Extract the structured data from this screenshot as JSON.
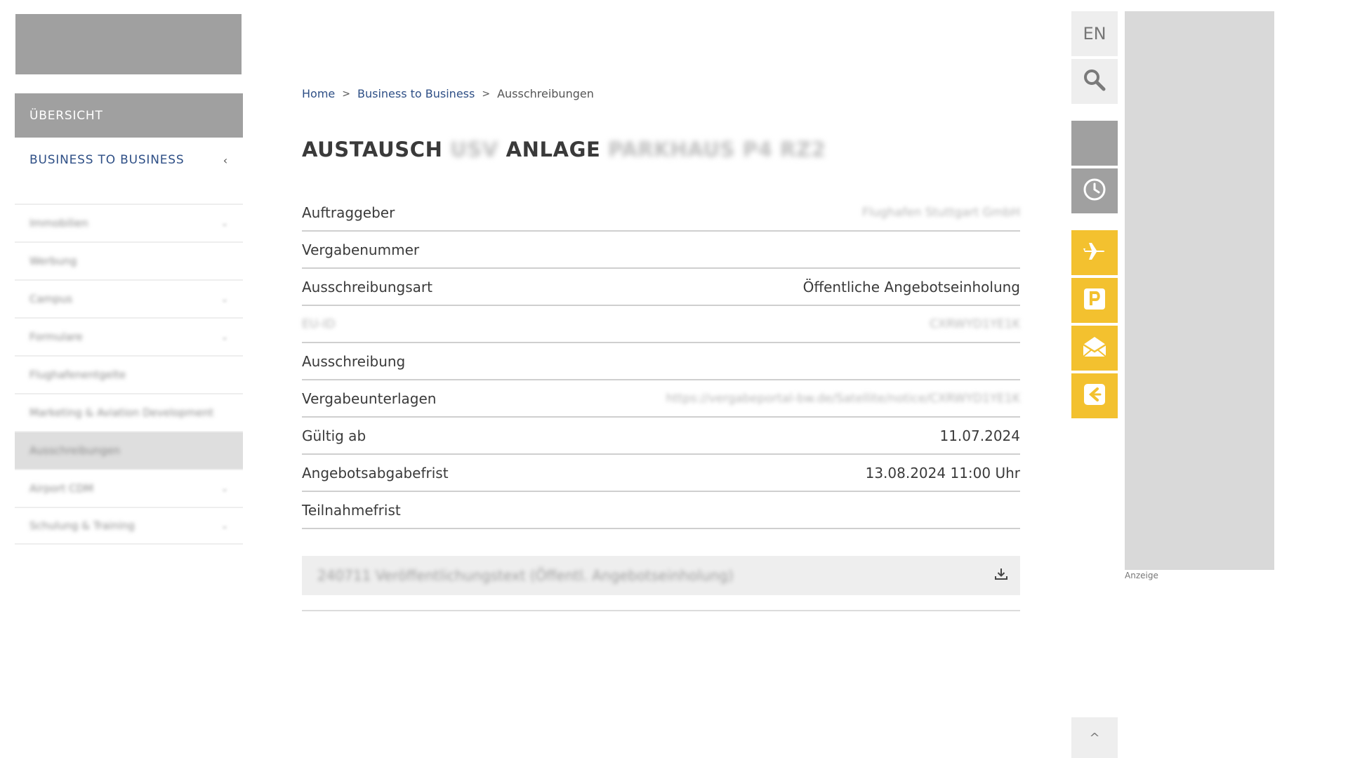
{
  "sidebar": {
    "overview_label": "ÜBERSICHT",
    "section_label": "BUSINESS TO BUSINESS",
    "section_chevron": "‹",
    "items": [
      {
        "label": "Immobilien",
        "has_children": true,
        "active": false
      },
      {
        "label": "Werbung",
        "has_children": false,
        "active": false
      },
      {
        "label": "Campus",
        "has_children": true,
        "active": false
      },
      {
        "label": "Formulare",
        "has_children": true,
        "active": false
      },
      {
        "label": "Flughafenentgelte",
        "has_children": false,
        "active": false
      },
      {
        "label": "Marketing & Aviation Development",
        "has_children": false,
        "active": false
      },
      {
        "label": "Ausschreibungen",
        "has_children": false,
        "active": true
      },
      {
        "label": "Airport CDM",
        "has_children": true,
        "active": false
      },
      {
        "label": "Schulung & Training",
        "has_children": true,
        "active": false
      }
    ]
  },
  "breadcrumb": {
    "home": "Home",
    "level1": "Business to Business",
    "current": "Ausschreibungen",
    "separator": ">"
  },
  "title": {
    "part1": "AUSTAUSCH",
    "blur1": "USV",
    "part2": "ANLAGE",
    "blur2": "PARKHAUS P4 RZ2"
  },
  "details": [
    {
      "label": "Auftraggeber",
      "value": "Flughafen Stuttgart GmbH",
      "label_blur": false,
      "value_blur": true
    },
    {
      "label": "Vergabenummer",
      "value": "",
      "label_blur": false,
      "value_blur": false
    },
    {
      "label": "Ausschreibungsart",
      "value": "Öffentliche Angebotseinholung",
      "label_blur": false,
      "value_blur": false
    },
    {
      "label": "EU-ID",
      "value": "CXRWYD1YE1K",
      "label_blur": true,
      "value_blur": true
    },
    {
      "label": "Ausschreibung",
      "value": "",
      "label_blur": false,
      "value_blur": false
    },
    {
      "label": "Vergabeunterlagen",
      "value": "https://vergabeportal-bw.de/Satellite/notice/CXRWYD1YE1K",
      "label_blur": false,
      "value_blur": true
    },
    {
      "label": "Gültig ab",
      "value": "11.07.2024",
      "label_blur": false,
      "value_blur": false
    },
    {
      "label": "Angebotsabgabefrist",
      "value": "13.08.2024 11:00 Uhr",
      "label_blur": false,
      "value_blur": false
    },
    {
      "label": "Teilnahmefrist",
      "value": "",
      "label_blur": false,
      "value_blur": false
    }
  ],
  "download": {
    "label": "240711 Veröffentlichungstext (Öffentl. Angebotseinholung)",
    "icon": "download-icon"
  },
  "right_tools": {
    "language": "EN",
    "icons": [
      "search-icon",
      "blank-tile",
      "clock-icon",
      "plane-icon",
      "parking-icon",
      "mail-icon",
      "feedback-icon"
    ],
    "to_top": "^"
  },
  "ad": {
    "label": "Anzeige"
  },
  "colors": {
    "accent_yellow": "#f3c12f",
    "link_blue": "#2e4f86",
    "grey_tile": "#a0a0a0",
    "light_tile": "#eeeeee"
  }
}
